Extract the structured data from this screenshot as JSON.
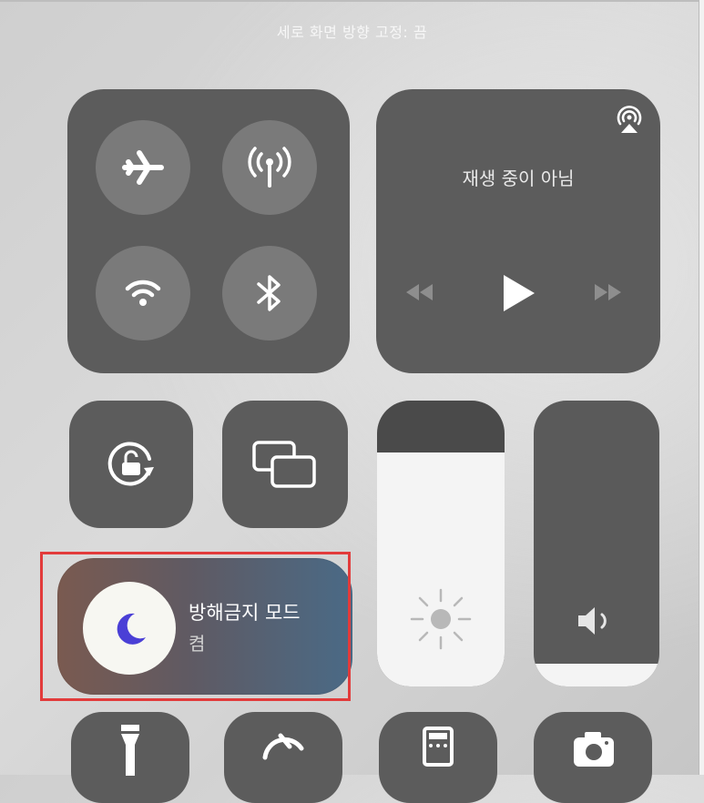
{
  "banner": {
    "text": "세로 화면 방향 고정: 끔"
  },
  "connectivity": {
    "airplane": {
      "icon": "airplane-icon"
    },
    "cellular": {
      "icon": "cellular-antenna-icon"
    },
    "wifi": {
      "icon": "wifi-icon"
    },
    "bluetooth": {
      "icon": "bluetooth-icon"
    }
  },
  "media": {
    "status": "재생 중이 아님",
    "airplay_icon": "airplay-audio-icon",
    "controls": [
      "rewind-icon",
      "play-icon",
      "fast-forward-icon"
    ]
  },
  "quick_toggles": [
    {
      "icon": "orientation-lock-icon"
    },
    {
      "icon": "screen-mirroring-icon"
    }
  ],
  "brightness": {
    "icon": "sun-icon",
    "level": 0.82
  },
  "volume": {
    "icon": "speaker-icon",
    "level": 0.08
  },
  "do_not_disturb": {
    "label": "방해금지 모드",
    "status": "켬",
    "icon": "moon-icon",
    "highlight_color": "#e23b3b"
  },
  "bottom_row": [
    "flashlight-icon",
    "timer-icon",
    "calculator-icon",
    "camera-icon"
  ],
  "colors": {
    "tile": "#5c5c5c",
    "circle": "#7a7a7a",
    "moon": "#4a3fd6"
  }
}
